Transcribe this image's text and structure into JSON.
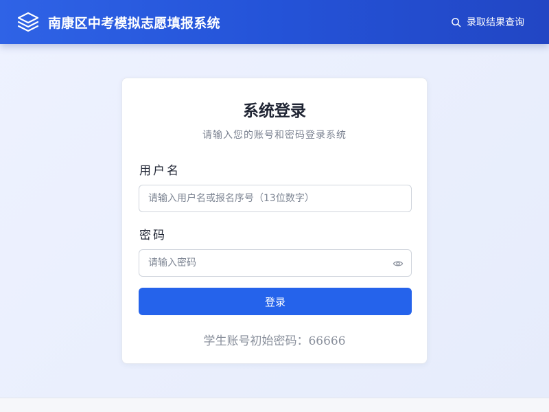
{
  "header": {
    "logo_icon": "layers-icon",
    "title": "南康区中考模拟志愿填报系统",
    "query_icon": "search-icon",
    "query_link": "录取结果查询"
  },
  "login": {
    "title": "系统登录",
    "subtitle": "请输入您的账号和密码登录系统",
    "username_label": "用户名",
    "username_placeholder": "请输入用户名或报名序号（13位数字）",
    "password_label": "密码",
    "password_placeholder": "请输入密码",
    "password_toggle_icon": "eye-icon",
    "submit_label": "登录",
    "hint": "学生账号初始密码：66666"
  },
  "colors": {
    "header_gradient_start": "#2f63e6",
    "header_gradient_end": "#2246c4",
    "primary_button": "#2563eb",
    "page_background": "#eef2ff"
  }
}
